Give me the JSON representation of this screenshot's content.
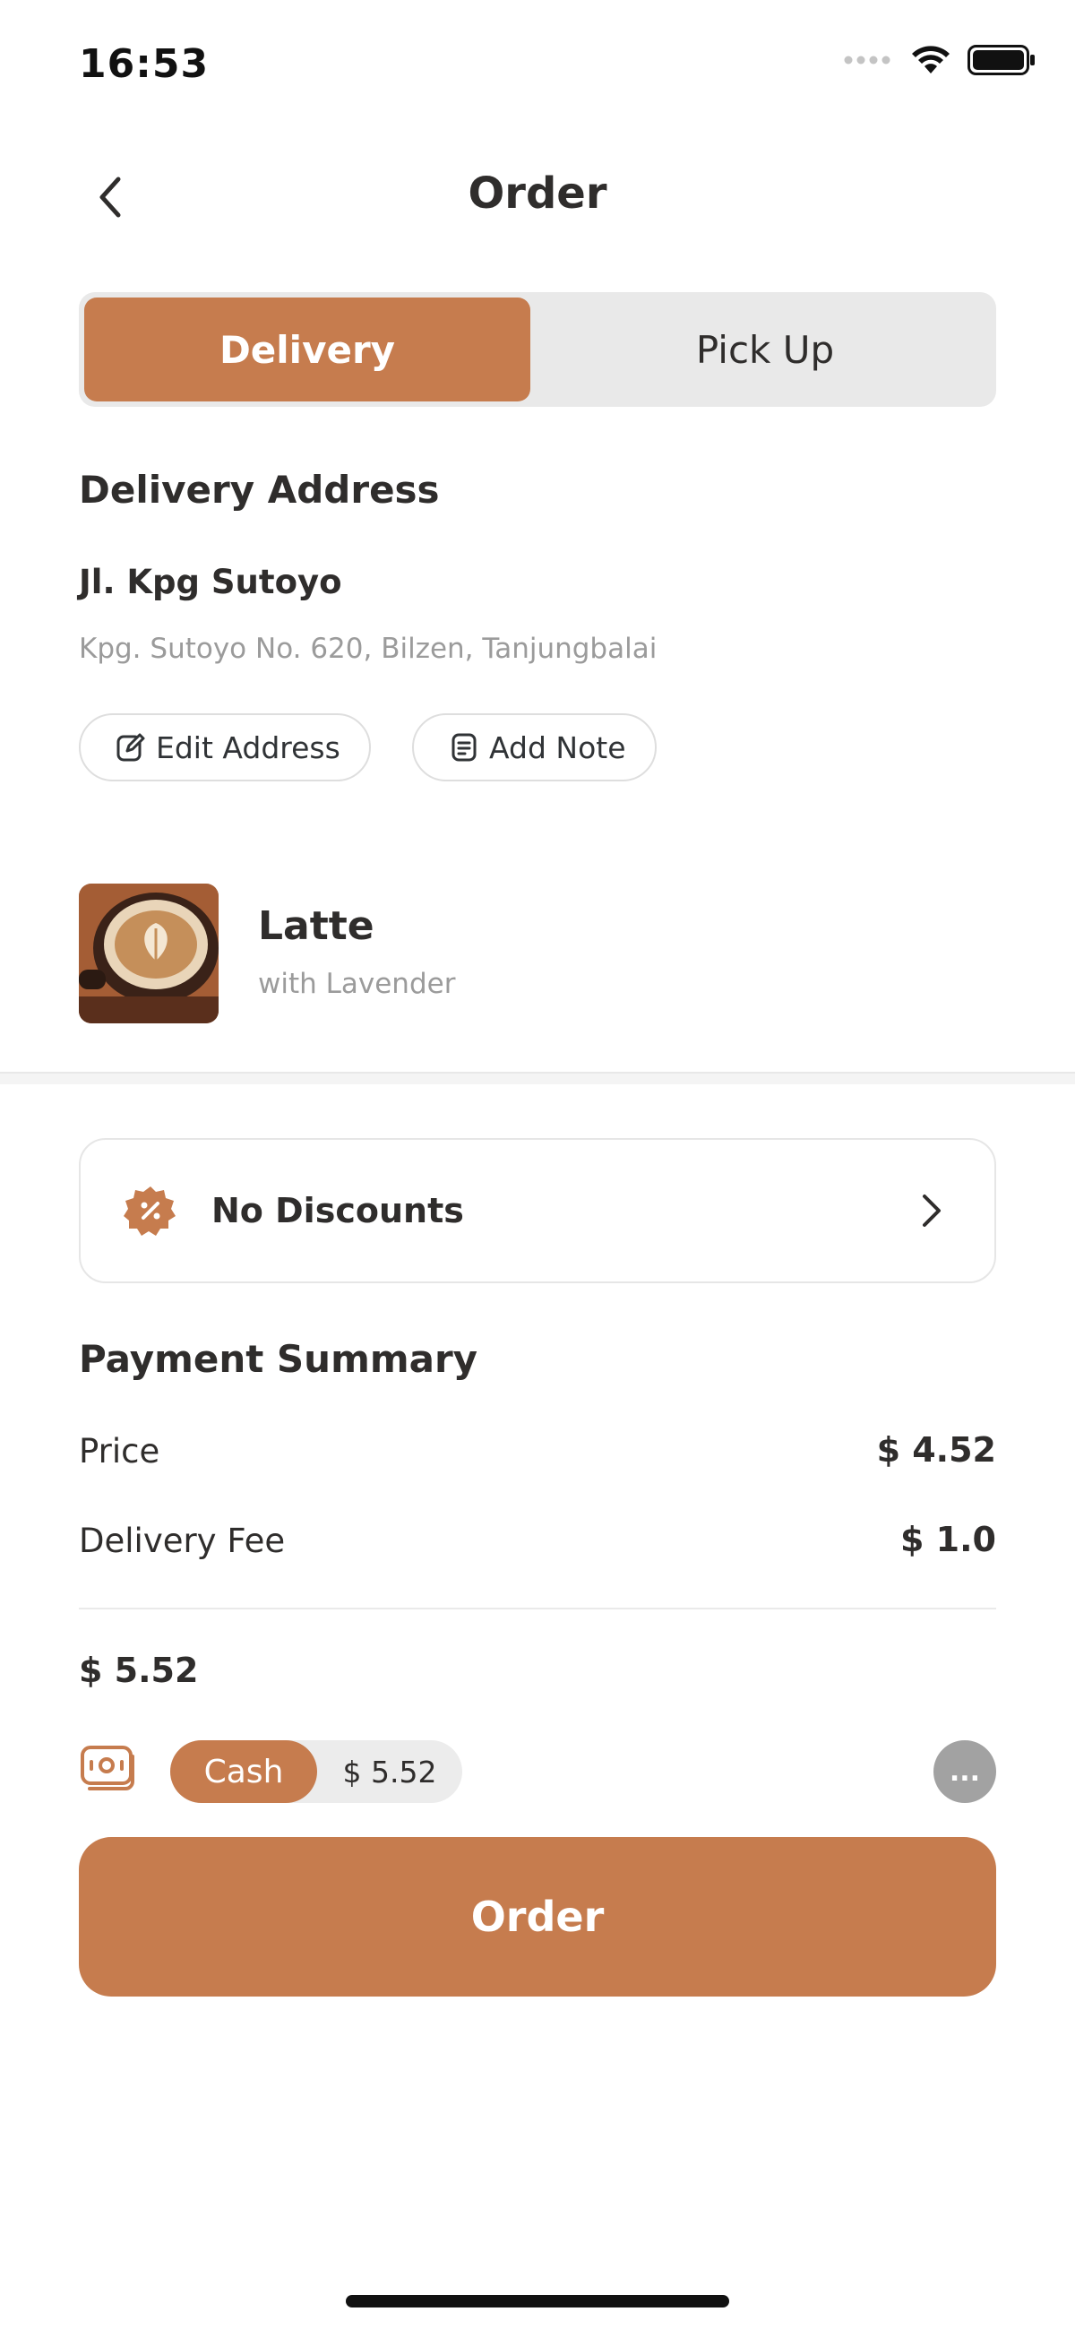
{
  "status_bar": {
    "time": "16:53"
  },
  "header": {
    "title": "Order"
  },
  "tabs": [
    {
      "label": "Delivery",
      "active": true
    },
    {
      "label": "Pick Up",
      "active": false
    }
  ],
  "delivery": {
    "section_title": "Delivery Address",
    "name": "Jl. Kpg Sutoyo",
    "detail": "Kpg. Sutoyo No. 620, Bilzen, Tanjungbalai",
    "edit_label": "Edit Address",
    "note_label": "Add Note"
  },
  "product": {
    "name": "Latte",
    "subtitle": "with Lavender"
  },
  "discount": {
    "label": "No Discounts"
  },
  "payment": {
    "section_title": "Payment Summary",
    "rows": [
      {
        "label": "Price",
        "value": "$ 4.52"
      },
      {
        "label": "Delivery Fee",
        "value": "$ 1.0"
      }
    ],
    "total": "$ 5.52",
    "method_label": "Cash",
    "method_amount": "$ 5.52",
    "more_label": "..."
  },
  "order_button": {
    "label": "Order"
  },
  "colors": {
    "accent": "#c67c4e",
    "text": "#2f2d2c",
    "muted": "#9b9b9b"
  }
}
